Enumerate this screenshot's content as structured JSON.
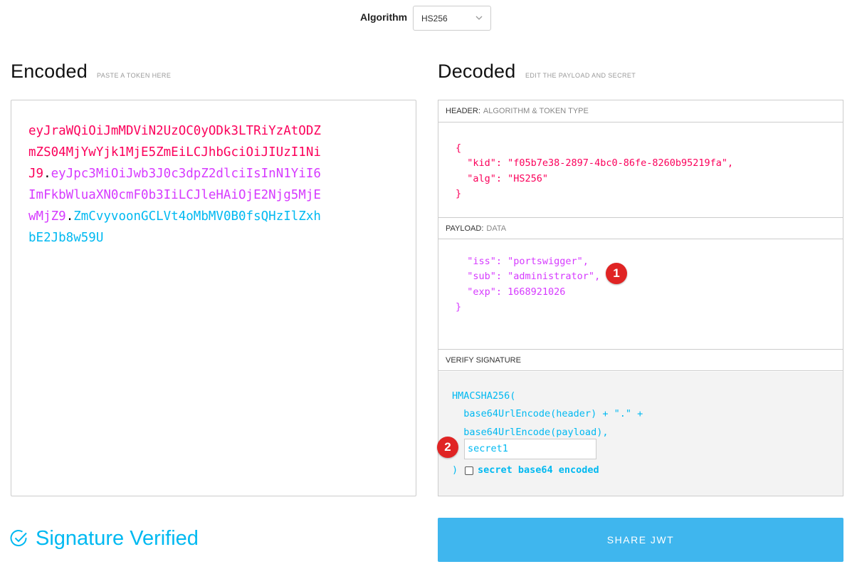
{
  "algorithm": {
    "label": "Algorithm",
    "selected": "HS256"
  },
  "encoded": {
    "title": "Encoded",
    "subtitle": "PASTE A TOKEN HERE",
    "lines": [
      [
        {
          "t": "eyJraWQiOiJmMDViN2UzOC0yODk3LTRiYzAtODZ",
          "p": "header"
        }
      ],
      [
        {
          "t": "mZS04MjYwYjk1MjE5ZmEiLCJhbGciOiJIUzI1Ni",
          "p": "header"
        }
      ],
      [
        {
          "t": "J9",
          "p": "header"
        },
        {
          "t": ".",
          "p": "dot"
        },
        {
          "t": "eyJpc3MiOiJwb3J0c3dpZ2dlciIsInN1YiI6",
          "p": "payload"
        }
      ],
      [
        {
          "t": "ImFkbWluaXN0cmF0b3IiLCJleHAiOjE2Njg5MjE",
          "p": "payload"
        }
      ],
      [
        {
          "t": "wMjZ9",
          "p": "payload"
        },
        {
          "t": ".",
          "p": "dot"
        },
        {
          "t": "ZmCvyvoonGCLVt4oMbMV0B0fsQHzIlZxh",
          "p": "sig"
        }
      ],
      [
        {
          "t": "bE2Jb8w59U",
          "p": "sig"
        }
      ]
    ]
  },
  "decoded": {
    "title": "Decoded",
    "subtitle": "EDIT THE PAYLOAD AND SECRET",
    "header_section": {
      "label": "HEADER:",
      "muted": "ALGORITHM & TOKEN TYPE",
      "code": "{\n  \"kid\": \"f05b7e38-2897-4bc0-86fe-8260b95219fa\",\n  \"alg\": \"HS256\"\n}"
    },
    "payload_section": {
      "label": "PAYLOAD:",
      "muted": "DATA",
      "code": "  \"iss\": \"portswigger\",\n  \"sub\": \"administrator\",\n  \"exp\": 1668921026\n}"
    },
    "verify_section": {
      "label": "VERIFY SIGNATURE",
      "code": "HMACSHA256(\n  base64UrlEncode(header) + \".\" +\n  base64UrlEncode(payload),",
      "secret_value": "secret1",
      "close_paren": ")",
      "base64_label": "secret base64 encoded",
      "base64_checked": false
    }
  },
  "annotations": {
    "badge1": "1",
    "badge2": "2"
  },
  "status": {
    "verified_text": "Signature Verified"
  },
  "share_button": "SHARE JWT",
  "colors": {
    "header": "#fb015b",
    "payload": "#d63aff",
    "signature": "#00b9f1",
    "share_button": "#3fb6ee",
    "badge": "#e02424"
  }
}
